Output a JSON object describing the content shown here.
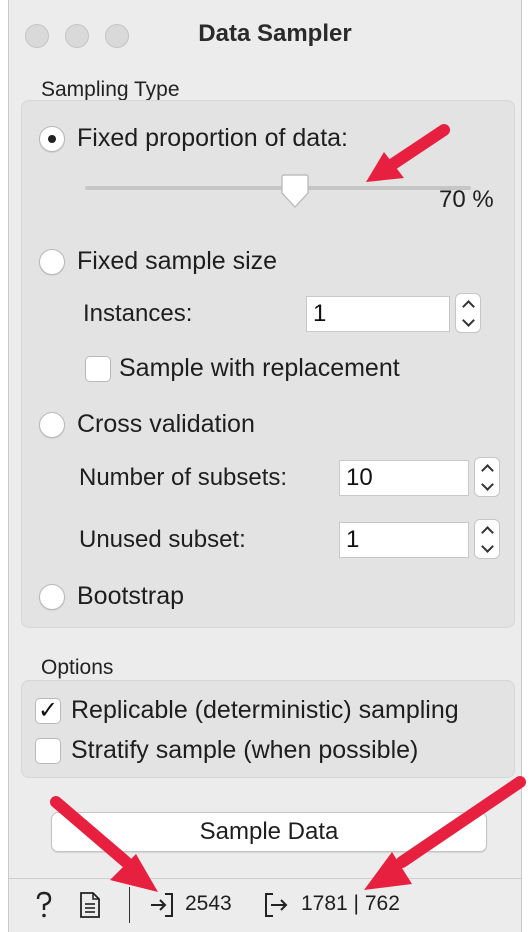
{
  "window": {
    "title": "Data Sampler"
  },
  "sampling": {
    "section_label": "Sampling Type",
    "fixed_proportion": {
      "label": "Fixed proportion of data:",
      "selected": true,
      "value_pct": 70,
      "value_text": "70 %"
    },
    "fixed_size": {
      "label": "Fixed sample size",
      "instances_label": "Instances:",
      "instances_value": "1",
      "replacement_label": "Sample with replacement",
      "replacement_checked": false
    },
    "cross_validation": {
      "label": "Cross validation",
      "subsets_label": "Number of subsets:",
      "subsets_value": "10",
      "unused_label": "Unused subset:",
      "unused_value": "1"
    },
    "bootstrap": {
      "label": "Bootstrap"
    }
  },
  "options": {
    "section_label": "Options",
    "replicable": {
      "label": "Replicable (deterministic) sampling",
      "checked": true,
      "mark": "✓"
    },
    "stratify": {
      "label": "Stratify sample (when possible)",
      "checked": false
    }
  },
  "actions": {
    "sample_button": "Sample Data"
  },
  "status": {
    "help_icon": "question-icon",
    "report_icon": "document-icon",
    "input_count": "2543",
    "output_count": "1781 | 762"
  },
  "colors": {
    "arrow": "#e8203f",
    "radio_dot": "#222222"
  }
}
